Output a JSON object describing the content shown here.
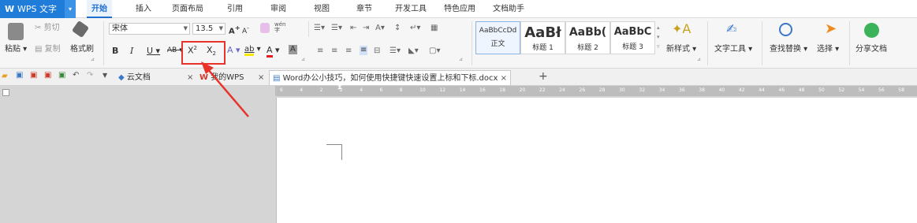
{
  "app": {
    "title": "WPS 文字"
  },
  "menu": {
    "items": [
      "开始",
      "插入",
      "页面布局",
      "引用",
      "审阅",
      "视图",
      "章节",
      "开发工具",
      "特色应用",
      "文档助手"
    ]
  },
  "clipboard": {
    "paste": "粘贴",
    "cut": "剪切",
    "copy": "复制",
    "format_painter": "格式刷"
  },
  "font": {
    "family": "宋体",
    "size": "13.5",
    "grow": "A",
    "shrink": "A",
    "bold": "B",
    "italic": "I",
    "underline": "U",
    "strike": "AB",
    "superscript": "X",
    "superscript_mark": "2",
    "subscript": "X",
    "subscript_mark": "2",
    "char_shade": "A",
    "highlight": "ab",
    "font_color": "A",
    "char_border": "A",
    "phonetic": "wén",
    "phonetic_char": "字"
  },
  "styles": [
    {
      "sample": "AaBbCcDd",
      "name": "正文"
    },
    {
      "sample": "AaBł",
      "name": "标题 1"
    },
    {
      "sample": "AaBb(",
      "name": "标题 2"
    },
    {
      "sample": "AaBbC",
      "name": "标题 3"
    }
  ],
  "ribbon_buttons": {
    "new_style": "新样式",
    "text_tools": "文字工具",
    "find_replace": "查找替换",
    "select": "选择",
    "share": "分享文档"
  },
  "tabs": [
    {
      "label": "云文档"
    },
    {
      "label": "我的WPS"
    },
    {
      "label": "Word办公小技巧，如何使用快捷键快速设置上标和下标.docx"
    }
  ],
  "ruler": {
    "ticks": [
      "6",
      "4",
      "2",
      "2",
      "4",
      "6",
      "8",
      "10",
      "12",
      "14",
      "16",
      "18",
      "20",
      "22",
      "24",
      "26",
      "28",
      "30",
      "32",
      "34",
      "36",
      "38",
      "40",
      "42",
      "44",
      "46",
      "48",
      "50",
      "52",
      "54",
      "56",
      "58"
    ]
  },
  "colors": {
    "accent": "#1f7cd8",
    "highlight_box": "#e8332a",
    "font_color_bar": "#e02020",
    "highlight_bar": "#ffe600"
  }
}
